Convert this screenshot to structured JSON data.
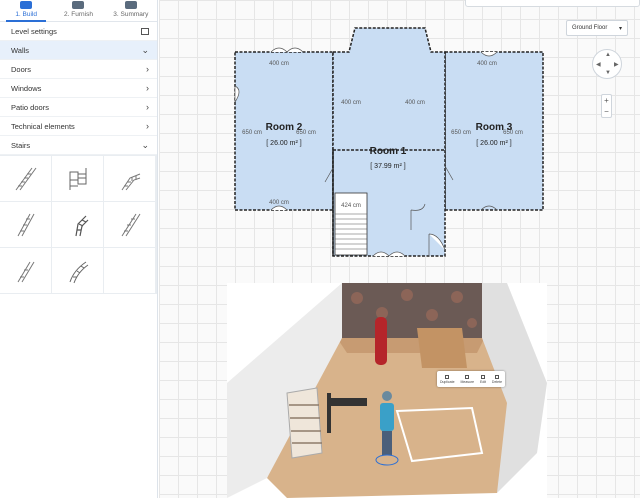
{
  "tabs": [
    {
      "label": "1. Build",
      "icon": "build-icon",
      "active": true
    },
    {
      "label": "2. Furnish",
      "icon": "sofa-icon",
      "active": false
    },
    {
      "label": "3. Summary",
      "icon": "summary-icon",
      "active": false
    }
  ],
  "sidebar": {
    "level_settings": "Level settings",
    "items": [
      {
        "label": "Walls",
        "state": "expanded"
      },
      {
        "label": "Doors",
        "state": "collapsed"
      },
      {
        "label": "Windows",
        "state": "collapsed"
      },
      {
        "label": "Patio doors",
        "state": "collapsed"
      },
      {
        "label": "Technical elements",
        "state": "collapsed"
      },
      {
        "label": "Stairs",
        "state": "expanded"
      }
    ],
    "stair_types": [
      "straight-stair-icon",
      "u-shaped-stair-icon",
      "l-shaped-stair-icon",
      "straight-stair-icon",
      "quarter-turn-stair-icon",
      "straight-stair-icon",
      "straight-stair-icon",
      "curved-stair-icon"
    ]
  },
  "floor_selector": {
    "value": "Ground Floor"
  },
  "zoom": {
    "plus": "+",
    "minus": "−"
  },
  "plan": {
    "rooms": [
      {
        "name": "Room 2",
        "area": "[ 26.00 m² ]"
      },
      {
        "name": "Room 1",
        "area": "[ 37.99 m² ]"
      },
      {
        "name": "Room 3",
        "area": "[ 26.00 m² ]"
      }
    ],
    "dimensions": [
      "400 cm",
      "400 cm",
      "400 cm",
      "400 cm",
      "650 cm",
      "650 cm",
      "650 cm",
      "650 cm",
      "400 cm",
      "424 cm"
    ]
  },
  "context_menu": [
    "Duplicate",
    "Measure",
    "Edit",
    "Delete"
  ],
  "colors": {
    "accent": "#2b6fd6",
    "room_fill": "#c9ddf3",
    "selected_row": "#e7f0fb"
  }
}
